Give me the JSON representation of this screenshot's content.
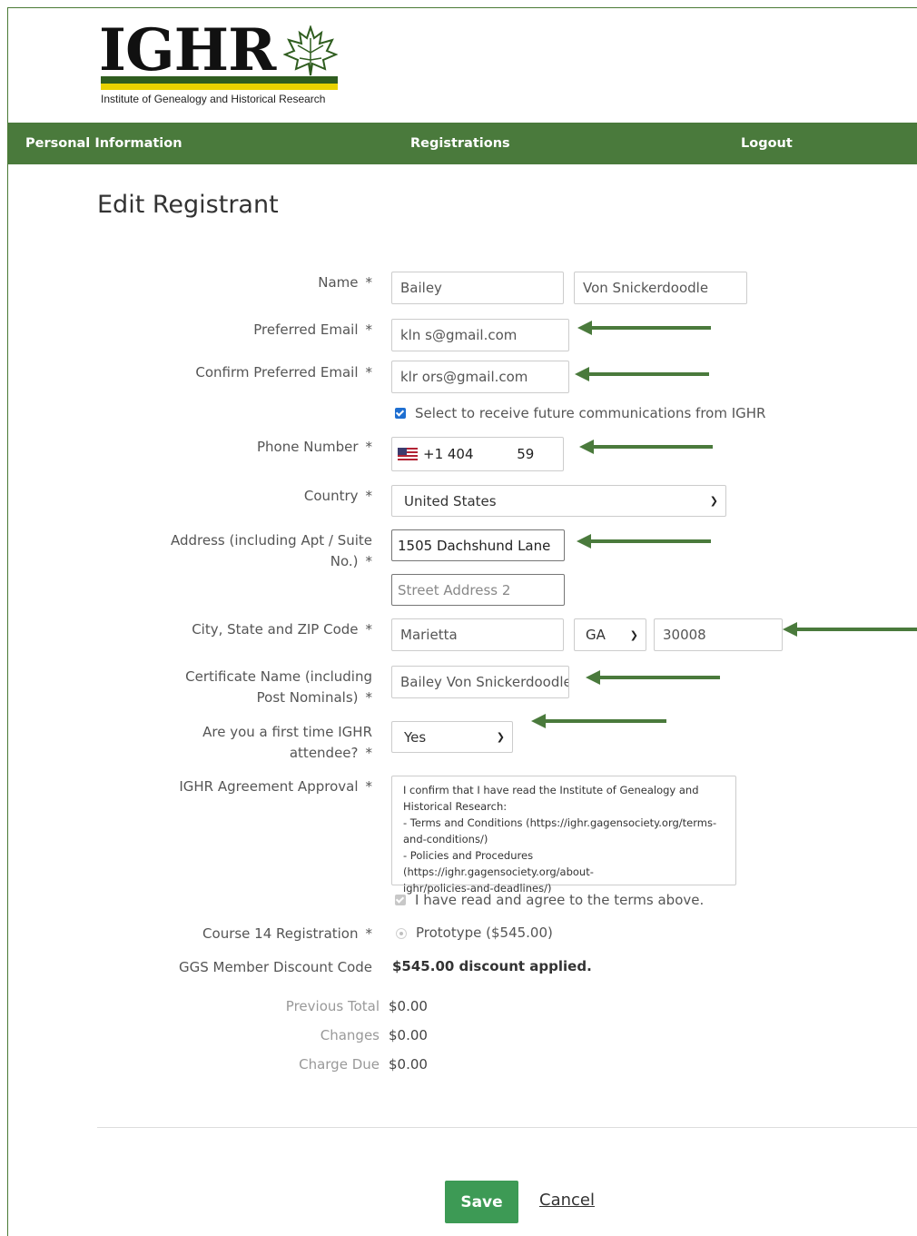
{
  "logo": {
    "text": "IGHR",
    "subtitle": "Institute of Genealogy and Historical Research"
  },
  "nav": {
    "items": [
      "Personal Information",
      "Registrations",
      "Logout"
    ]
  },
  "page_title": "Edit Registrant",
  "form": {
    "name_label": "Name",
    "first_name": "Bailey",
    "last_name": "Von Snickerdoodle",
    "email_label": "Preferred Email",
    "email_value": "kln                   s@gmail.com",
    "confirm_email_label": "Confirm Preferred Email",
    "confirm_email_value": "klr                  ors@gmail.com",
    "comms_label": "Select to receive future communications from IGHR",
    "comms_checked": true,
    "phone_label": "Phone Number",
    "phone_value": "+1 404          59",
    "country_label": "Country",
    "country_value": "United States",
    "address_label_line1": "Address (including Apt / Suite",
    "address_label_line2": "No.)",
    "address1_value": "1505 Dachshund Lane",
    "address2_placeholder": "Street Address 2",
    "city_label": "City, State and ZIP Code",
    "city_value": "Marietta",
    "state_value": "GA",
    "zip_value": "30008",
    "cert_label_line1": "Certificate Name (including",
    "cert_label_line2": "Post Nominals)",
    "cert_value": "Bailey Von Snickerdoodle",
    "first_time_label_line1": "Are you a first time IGHR",
    "first_time_label_line2": "attendee?",
    "first_time_value": "Yes",
    "agreement_label": "IGHR Agreement Approval",
    "agreement_text": [
      "I confirm that I have read the Institute of Genealogy and",
      "Historical Research:",
      "- Terms and Conditions (https://ighr.gagensociety.org/terms-",
      "and-conditions/)",
      "- Policies and Procedures (https://ighr.gagensociety.org/about-",
      "ighr/policies-and-deadlines/)"
    ],
    "agree_label": "I have read and agree to the terms above.",
    "course_label": "Course 14 Registration",
    "course_option": "Prototype ($545.00)",
    "discount_label": "GGS Member Discount Code",
    "discount_value": "$545.00 discount applied.",
    "required_mark": "*"
  },
  "totals": {
    "previous_label": "Previous Total",
    "previous_value": "$0.00",
    "changes_label": "Changes",
    "changes_value": "$0.00",
    "due_label": "Charge Due",
    "due_value": "$0.00"
  },
  "actions": {
    "save": "Save",
    "cancel": "Cancel"
  },
  "colors": {
    "brand_green": "#4a7a3c",
    "save_green": "#3d9a55",
    "arrow_green": "#4a7a3c"
  }
}
